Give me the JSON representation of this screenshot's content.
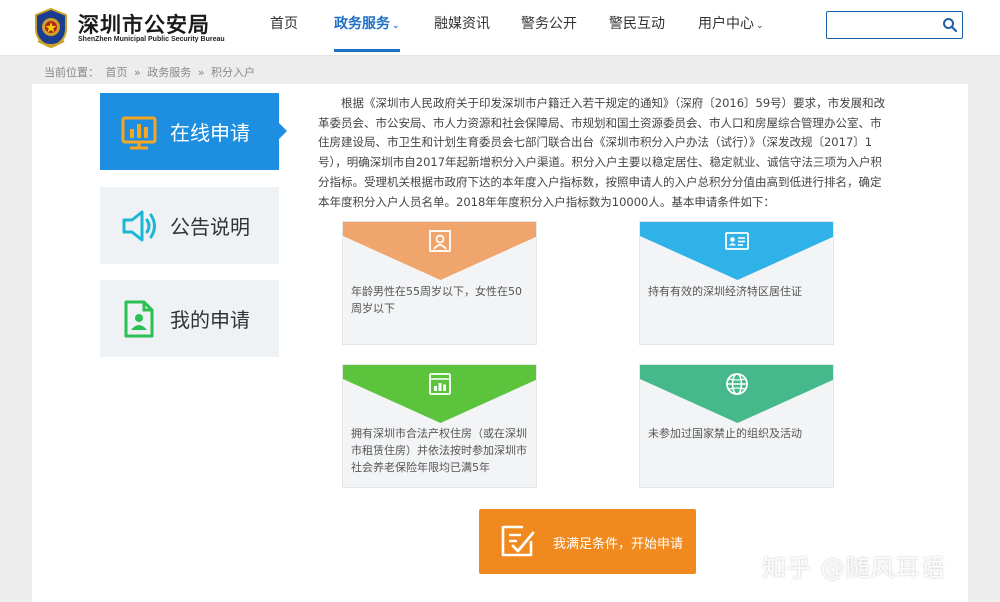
{
  "header": {
    "site_title": "深圳市公安局",
    "site_subtitle": "ShenZhen Municipal Public Security Bureau",
    "nav": [
      {
        "label": "首页"
      },
      {
        "label": "政务服务",
        "active": true,
        "has_dropdown": true
      },
      {
        "label": "融媒资讯"
      },
      {
        "label": "警务公开"
      },
      {
        "label": "警民互动"
      },
      {
        "label": "用户中心",
        "has_dropdown": true
      }
    ],
    "search": {
      "value": "",
      "placeholder": "",
      "icon": "search-icon"
    },
    "accent_color": "#1f6fc6"
  },
  "breadcrumb": {
    "prefix": "当前位置：",
    "items": [
      "首页",
      "»",
      "政务服务",
      "»",
      "积分入户"
    ]
  },
  "sidebar": {
    "tabs": [
      {
        "label": "在线申请",
        "icon": "bar-chart-icon",
        "active": true
      },
      {
        "label": "公告说明",
        "icon": "speaker-icon"
      },
      {
        "label": "我的申请",
        "icon": "document-user-icon"
      }
    ],
    "active_color": "#1e8fe0"
  },
  "intro": "根据《深圳市人民政府关于印发深圳市户籍迁入若干规定的通知》（深府〔2016〕59号）要求，市发展和改革委员会、市公安局、市人力资源和社会保障局、市规划和国土资源委员会、市人口和房屋综合管理办公室、市住房建设局、市卫生和计划生育委员会七部门联合出台《深圳市积分入户办法（试行）》（深发改规〔2017〕1号），明确深圳市自2017年起新增积分入户渠道。积分入户主要以稳定居住、稳定就业、诚信守法三项为入户积分指标。受理机关根据市政府下达的本年度入户指标数，按照申请人的入户总积分分值由高到低进行排名，确定本年度积分入户人员名单。2018年年度积分入户指标数为10000人。基本申请条件如下：",
  "conditions": [
    {
      "text": "年龄男性在55周岁以下，女性在50周岁以下",
      "icon": "person-icon",
      "color": "#f0a56d"
    },
    {
      "text": "持有有效的深圳经济特区居住证",
      "icon": "id-card-icon",
      "color": "#2fb2e8"
    },
    {
      "text": "拥有深圳市合法产权住房（或在深圳市租赁住房）并依法按时参加深圳市社会养老保险年限均已满5年",
      "icon": "stats-icon",
      "color": "#5cc33d"
    },
    {
      "text": "未参加过国家禁止的组织及活动",
      "icon": "globe-icon",
      "color": "#45b88c"
    }
  ],
  "apply_button": {
    "label": "我满足条件，开始申请",
    "icon": "checklist-icon",
    "color": "#f08a1e"
  },
  "watermark": "知乎 @随风耳语"
}
